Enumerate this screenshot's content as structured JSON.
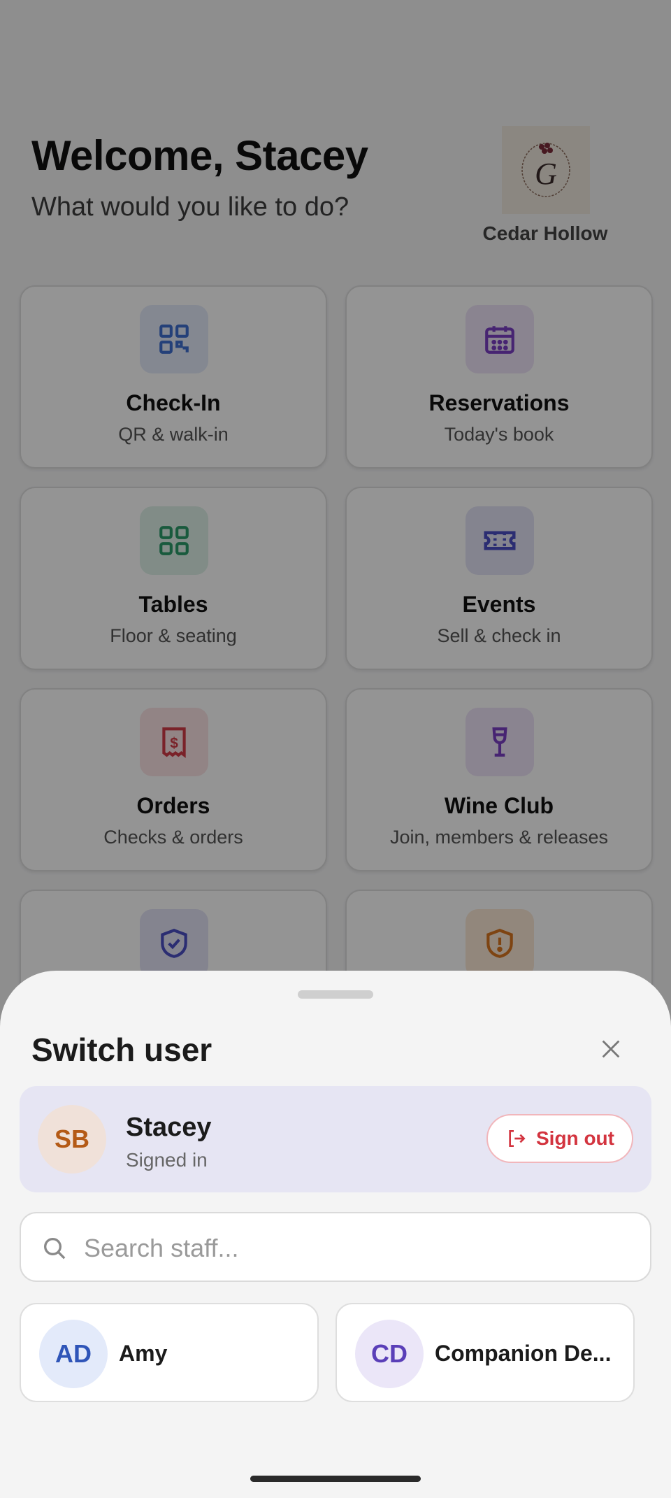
{
  "header": {
    "greeting": "Welcome, Stacey",
    "subtitle": "What would you like to do?",
    "venue_name": "Cedar Hollow",
    "logo_letter": "G"
  },
  "tiles": [
    {
      "title": "Check-In",
      "subtitle": "QR & walk-in",
      "icon": "qr-code-icon",
      "color": "#3f6fd0",
      "bg": "#e4eafa"
    },
    {
      "title": "Reservations",
      "subtitle": "Today's book",
      "icon": "calendar-icon",
      "color": "#7b3fc4",
      "bg": "#eee3f8"
    },
    {
      "title": "Tables",
      "subtitle": "Floor & seating",
      "icon": "grid-icon",
      "color": "#2b9b6a",
      "bg": "#dff2e9"
    },
    {
      "title": "Events",
      "subtitle": "Sell & check in",
      "icon": "ticket-icon",
      "color": "#4a4fc4",
      "bg": "#e4e4f7"
    },
    {
      "title": "Orders",
      "subtitle": "Checks & orders",
      "icon": "receipt-icon",
      "color": "#d23c47",
      "bg": "#fbe3e5"
    },
    {
      "title": "Wine Club",
      "subtitle": "Join, members & releases",
      "icon": "wine-glass-icon",
      "color": "#7b3fc4",
      "bg": "#eee3f8"
    },
    {
      "title": "",
      "subtitle": "",
      "icon": "shield-check-icon",
      "color": "#4a4fc4",
      "bg": "#e4e4f7"
    },
    {
      "title": "",
      "subtitle": "",
      "icon": "alert-shield-icon",
      "color": "#d9761f",
      "bg": "#fbe8d6"
    }
  ],
  "sheet": {
    "title": "Switch user",
    "current_user": {
      "initials": "SB",
      "name": "Stacey",
      "status": "Signed in"
    },
    "sign_out_label": "Sign out",
    "search_placeholder": "Search staff...",
    "staff": [
      {
        "initials": "AD",
        "name": "Amy",
        "avatar_color": "#2f55b8",
        "avatar_bg": "#e3eafa"
      },
      {
        "initials": "CD",
        "name": "Companion De...",
        "avatar_color": "#5a3fb8",
        "avatar_bg": "#ebe6f8"
      }
    ]
  },
  "colors": {
    "accent": "#d3343f",
    "scrim": "rgba(0,0,0,0.42)",
    "sheet_bg": "#f4f4f4",
    "current_card_bg": "#e6e5f3"
  }
}
